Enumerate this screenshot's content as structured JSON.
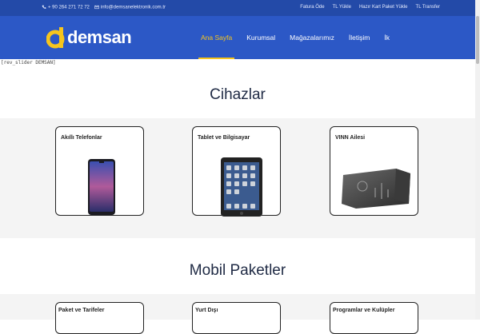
{
  "topbar": {
    "phone": "+ 90 264 271 72 72",
    "email": "info@demsanelektronik.com.tr",
    "links": [
      "Fatura Öde",
      "TL Yükle",
      "Hazır Kart Paket Yükle",
      "TL Transfer"
    ]
  },
  "brand": {
    "logo_letter": "d",
    "name": "demsan"
  },
  "nav": {
    "items": [
      "Ana Sayfa",
      "Kurumsal",
      "Mağazalarımız",
      "İletişim",
      "İk"
    ],
    "active": "Ana Sayfa"
  },
  "revslider_text": "[rev_slider DEMSAN]",
  "devices": {
    "title": "Cihazlar",
    "cards": [
      {
        "label": "Akıllı Telefonlar"
      },
      {
        "label": "Tablet ve Bilgisayar"
      },
      {
        "label": "VINN Ailesi"
      }
    ]
  },
  "packages": {
    "title": "Mobil Paketler",
    "cards": [
      {
        "label": "Paket ve Tarifeler"
      },
      {
        "label": "Yurt Dışı"
      },
      {
        "label": "Programlar ve Kulüpler"
      }
    ]
  },
  "colors": {
    "topbar": "#234aa8",
    "header": "#2c58c6",
    "accent": "#f6c51d"
  }
}
